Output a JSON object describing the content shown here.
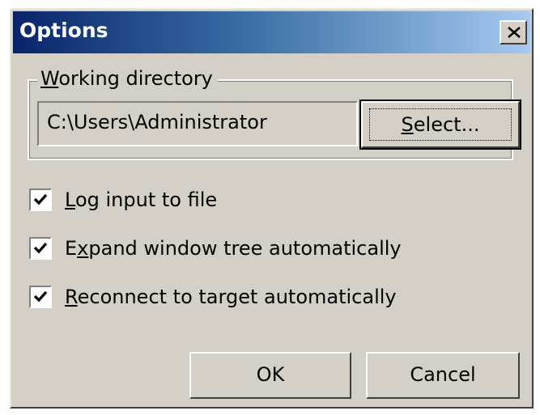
{
  "window": {
    "title": "Options",
    "close_label": "X"
  },
  "working_directory": {
    "group_label_prefix": "",
    "group_label_mnemonic": "W",
    "group_label_rest": "orking directory",
    "path_value": "C:\\Users\\Administrator",
    "select_button": {
      "mnemonic": "S",
      "rest": "elect..."
    }
  },
  "options": [
    {
      "label_prefix": "",
      "mnemonic": "L",
      "label_rest": "og input to file",
      "checked": true
    },
    {
      "label_prefix": "E",
      "mnemonic": "x",
      "label_rest": "pand window tree automatically",
      "checked": true
    },
    {
      "label_prefix": "",
      "mnemonic": "R",
      "label_rest": "econnect to target automatically",
      "checked": true
    }
  ],
  "buttons": {
    "ok_label": "OK",
    "cancel_label": "Cancel"
  },
  "colors": {
    "face": "#d4d0c8",
    "title_gradient_start": "#0a246a",
    "title_gradient_end": "#a6caf0",
    "title_text": "#ffffff"
  },
  "icons": {
    "close": "close-icon",
    "check": "checkmark-icon"
  }
}
